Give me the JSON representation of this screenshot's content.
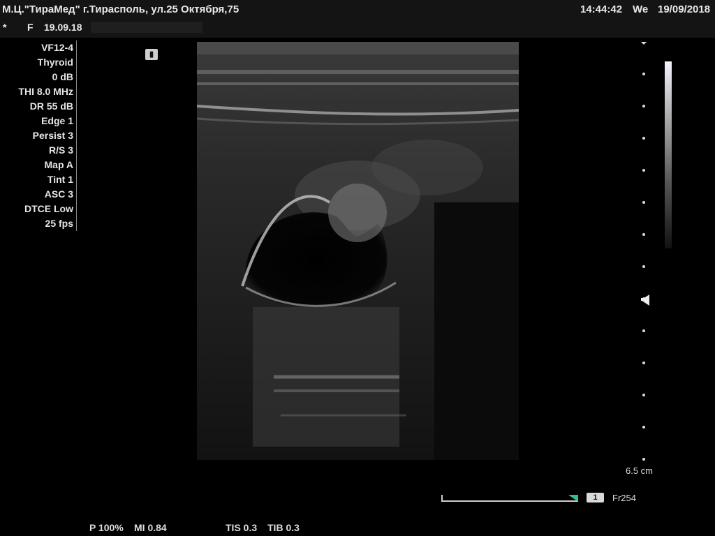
{
  "header": {
    "clinic": "М.Ц.\"ТираМед\" г.Тирасполь, ул.25 Октября,75",
    "time": "14:44:42",
    "weekday": "We",
    "date": "19/09/2018",
    "patient_marker": "*",
    "patient_sex": "F",
    "patient_date": "19.09.18"
  },
  "params": [
    "VF12-4",
    "Thyroid",
    "0 dB",
    "THI 8.0 MHz",
    "DR 55 dB",
    "Edge 1",
    "Persist 3",
    "R/S 3",
    "Map A",
    "Tint 1",
    "ASC 3",
    "DTCE Low",
    "25 fps"
  ],
  "depth": "6.5 cm",
  "cine": {
    "frame_index": "1",
    "frame_label": "Fr254",
    "accent": "#2fc08a"
  },
  "footer": {
    "power": "P 100%",
    "mi": "MI 0.84",
    "tis": "TIS 0.3",
    "tib": "TIB 0.3"
  },
  "icons": {
    "freeze": "freeze-icon",
    "focus": "focus-marker-icon"
  }
}
